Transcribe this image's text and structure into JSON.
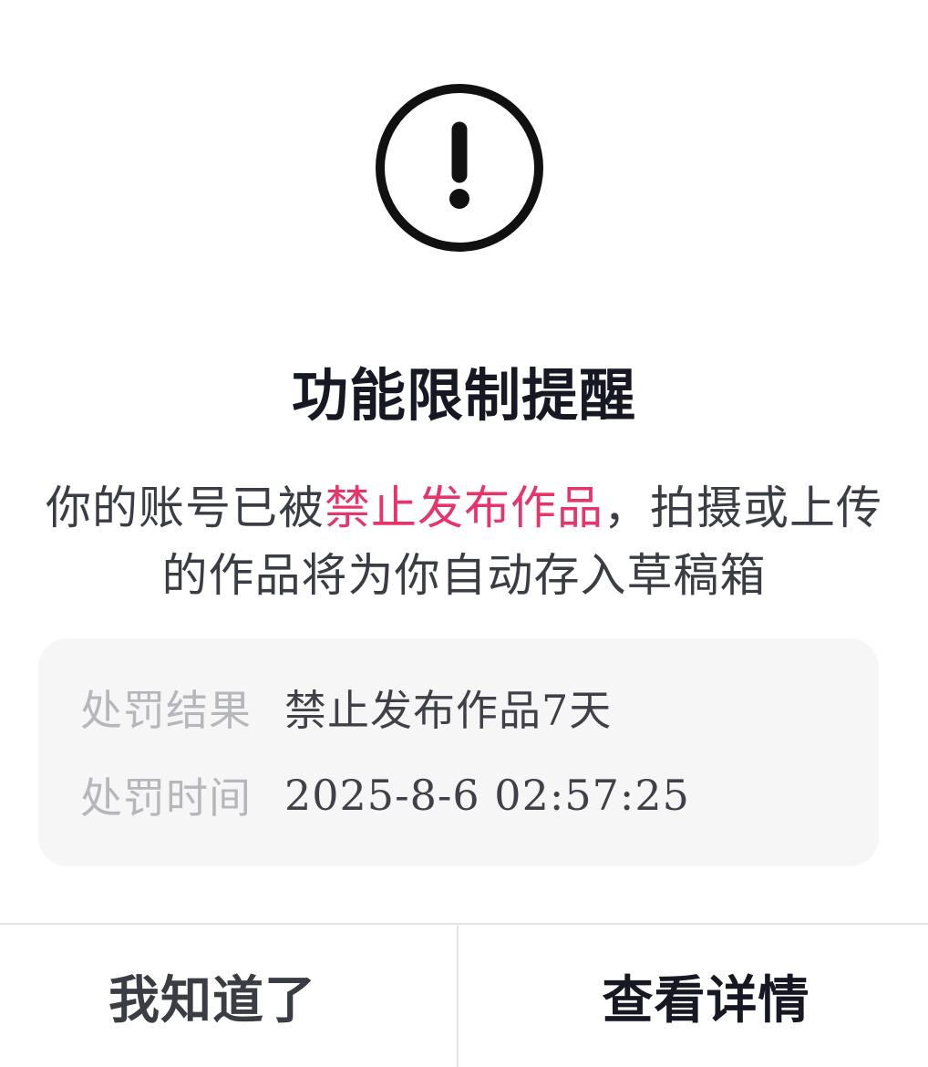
{
  "dialog": {
    "icon": "exclamation-circle-icon",
    "title": "功能限制提醒",
    "message": {
      "prefix": "你的账号已被",
      "highlight": "禁止发布作品",
      "suffix": "，拍摄或上传的作品将为你自动存入草稿箱"
    },
    "details": [
      {
        "label": "处罚结果",
        "value": "禁止发布作品7天"
      },
      {
        "label": "处罚时间",
        "value": "2025-8-6 02:57:25"
      }
    ],
    "buttons": {
      "dismiss": "我知道了",
      "view_details": "查看详情"
    },
    "colors": {
      "highlight": "#e5356a",
      "title": "#161823",
      "muted_label": "#b6b7bb",
      "info_background": "#f6f6f7"
    }
  }
}
